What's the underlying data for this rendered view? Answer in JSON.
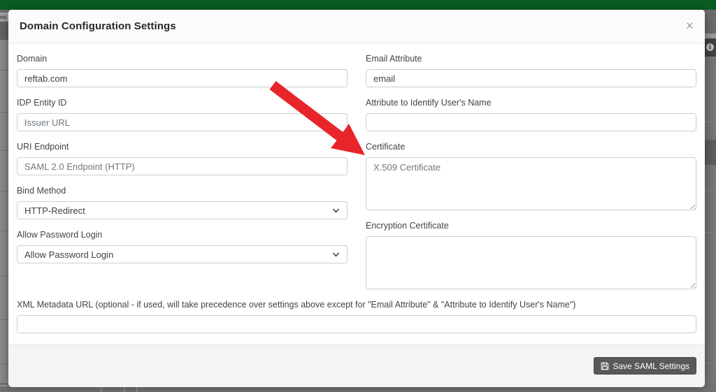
{
  "chrome": {
    "top_bar_color": "#0b5c23",
    "background_text_fragment": "ea",
    "info_icon_glyph": "i"
  },
  "modal": {
    "title": "Domain Configuration Settings",
    "close_glyph": "×",
    "fields": {
      "domain": {
        "label": "Domain",
        "value": "reftab.com"
      },
      "idp_entity_id": {
        "label": "IDP Entity ID",
        "placeholder": "Issuer URL",
        "value": ""
      },
      "uri_endpoint": {
        "label": "URI Endpoint",
        "placeholder": "SAML 2.0 Endpoint (HTTP)",
        "value": ""
      },
      "bind_method": {
        "label": "Bind Method",
        "selected": "HTTP-Redirect"
      },
      "allow_password_login": {
        "label": "Allow Password Login",
        "selected": "Allow Password Login"
      },
      "email_attribute": {
        "label": "Email Attribute",
        "value": "email"
      },
      "name_attribute": {
        "label": "Attribute to Identify User's Name",
        "value": "",
        "placeholder": ""
      },
      "certificate": {
        "label": "Certificate",
        "placeholder": "X.509 Certificate",
        "value": ""
      },
      "encryption_certificate": {
        "label": "Encryption Certificate",
        "placeholder": "",
        "value": ""
      },
      "xml_metadata_url": {
        "label": "XML Metadata URL (optional - if used, will take precedence over settings above except for \"Email Attribute\" & \"Attribute to Identify User's Name\")",
        "value": "",
        "placeholder": ""
      }
    },
    "footer": {
      "save_label": "Save SAML Settings"
    }
  },
  "annotation": {
    "arrow_color": "#e8252a",
    "arrow_points_to": "certificate-field"
  }
}
